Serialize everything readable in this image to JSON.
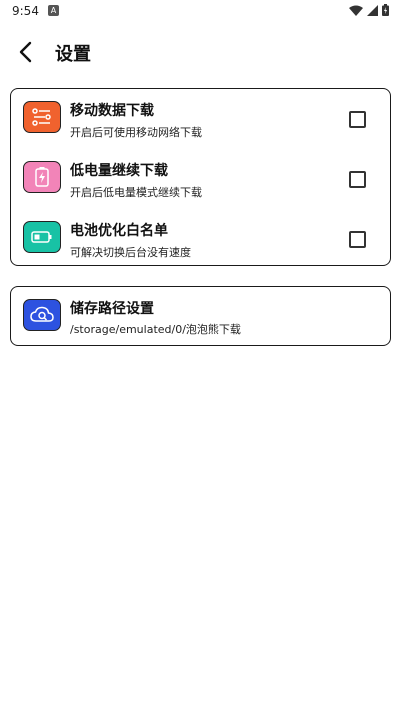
{
  "status": {
    "time": "9:54",
    "notification_letter": "A"
  },
  "header": {
    "title": "设置"
  },
  "settings": [
    {
      "title": "移动数据下载",
      "subtitle": "开启后可使用移动网络下载",
      "icon": "list-settings-icon",
      "color": "#F0622E",
      "checked": false
    },
    {
      "title": "低电量继续下载",
      "subtitle": "开启后低电量模式继续下载",
      "icon": "battery-charging-icon",
      "color": "#F284B8",
      "checked": false
    },
    {
      "title": "电池优化白名单",
      "subtitle": "可解决切换后台没有速度",
      "icon": "battery-icon",
      "color": "#18C2A5",
      "checked": false
    }
  ],
  "storage": {
    "title": "储存路径设置",
    "path": "/storage/emulated/0/泡泡熊下载",
    "icon": "cloud-search-icon",
    "color": "#2D52E0"
  }
}
